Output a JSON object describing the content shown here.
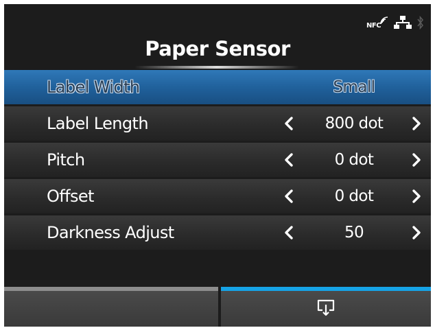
{
  "status": {
    "nfc_label": "NFC",
    "icons": [
      "nfc-icon",
      "network-icon",
      "bluetooth-icon"
    ]
  },
  "header": {
    "title": "Paper Sensor"
  },
  "settings": [
    {
      "label": "Label Width",
      "value": "Small",
      "selected": true,
      "arrows": false
    },
    {
      "label": "Label Length",
      "value": "800 dot",
      "selected": false,
      "arrows": true
    },
    {
      "label": "Pitch",
      "value": "0 dot",
      "selected": false,
      "arrows": true
    },
    {
      "label": "Offset",
      "value": "0 dot",
      "selected": false,
      "arrows": true
    },
    {
      "label": "Darkness Adjust",
      "value": "50",
      "selected": false,
      "arrows": true
    }
  ],
  "softkeys": {
    "left": {
      "icon": null
    },
    "right": {
      "icon": "apply-icon",
      "active": true
    }
  },
  "colors": {
    "selected_row": "#1f5f99",
    "active_tab": "#16a3e6",
    "inactive_tab": "#8d8d8d",
    "background": "#1c1c1c"
  }
}
